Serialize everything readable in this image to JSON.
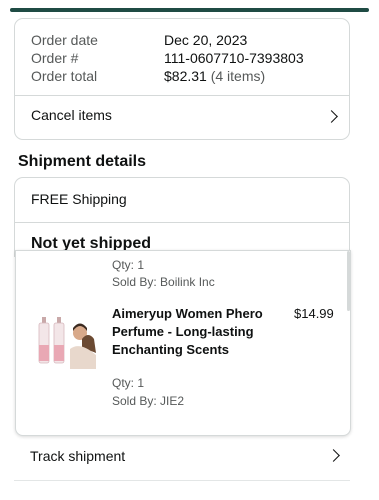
{
  "order": {
    "date_label": "Order date",
    "date_value": "Dec 20, 2023",
    "number_label": "Order #",
    "number_value": "111-0607710-7393803",
    "total_label": "Order total",
    "total_value": "$82.31",
    "total_items": "(4 items)",
    "cancel_label": "Cancel items"
  },
  "shipment": {
    "section_title": "Shipment details",
    "shipping_type": "FREE Shipping",
    "status": "Not yet shipped"
  },
  "items": [
    {
      "qty": "Qty: 1",
      "seller": "Sold By: Boilink Inc"
    },
    {
      "title": "Aimeryup Women Phero Perfume - Long-lasting Enchanting Scents",
      "price": "$14.99",
      "qty": "Qty: 1",
      "seller": "Sold By: JIE2"
    }
  ],
  "track": {
    "label": "Track shipment"
  },
  "colors": {
    "top_bar": "#1f4b44",
    "border": "#d5d9d9",
    "muted_text": "#565959"
  }
}
